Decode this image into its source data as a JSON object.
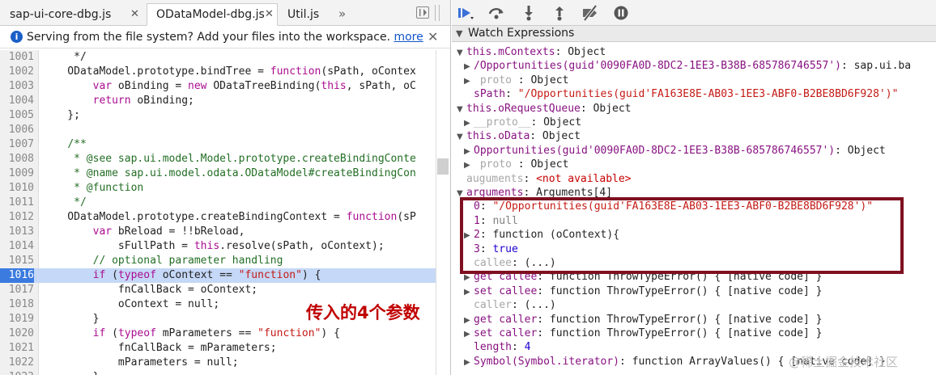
{
  "tabs": [
    {
      "label": "sap-ui-core-dbg.js",
      "close": "✕"
    },
    {
      "label": "ODataModel-dbg.js",
      "close": "✕"
    },
    {
      "label": "Util.js",
      "close": ""
    }
  ],
  "tab_overflow": "»",
  "infobar": {
    "icon": "i",
    "text": "Serving from the file system? Add your files into the workspace.",
    "link": "more",
    "close": "✕"
  },
  "code_lines": [
    {
      "n": "1001",
      "html": "     */"
    },
    {
      "n": "1002",
      "html": "    ODataModel.prototype.bindTree = <span class=\"k\">function</span>(sPath, oContex"
    },
    {
      "n": "1003",
      "html": "        <span class=\"k\">var</span> oBinding = <span class=\"k\">new</span> ODataTreeBinding(<span class=\"k\">this</span>, sPath, oC"
    },
    {
      "n": "1004",
      "html": "        <span class=\"k\">return</span> oBinding;"
    },
    {
      "n": "1005",
      "html": "    };"
    },
    {
      "n": "1006",
      "html": ""
    },
    {
      "n": "1007",
      "html": "    <span class=\"c\">/**</span>"
    },
    {
      "n": "1008",
      "html": "<span class=\"c\">     * @see sap.ui.model.Model.prototype.createBindingConte</span>"
    },
    {
      "n": "1009",
      "html": "<span class=\"c\">     * @name sap.ui.model.odata.ODataModel#createBindingCon</span>"
    },
    {
      "n": "1010",
      "html": "<span class=\"c\">     * @function</span>"
    },
    {
      "n": "1011",
      "html": "<span class=\"c\">     */</span>"
    },
    {
      "n": "1012",
      "html": "    ODataModel.prototype.createBindingContext = <span class=\"k\">function</span>(sP"
    },
    {
      "n": "1013",
      "html": "        <span class=\"k\">var</span> bReload = !!bReload,"
    },
    {
      "n": "1014",
      "html": "            sFullPath = <span class=\"k\">this</span>.resolve(sPath, oContext);"
    },
    {
      "n": "1015",
      "html": "        <span class=\"c\">// optional parameter handling</span>"
    },
    {
      "n": "1016",
      "html": "        <span class=\"k\">if</span> (<span class=\"k\">typeof</span> oContext == <span class=\"s\">\"function\"</span>) {",
      "hl": true
    },
    {
      "n": "1017",
      "html": "            fnCallBack = oContext;"
    },
    {
      "n": "1018",
      "html": "            oContext = null;"
    },
    {
      "n": "1019",
      "html": "        }"
    },
    {
      "n": "1020",
      "html": "        <span class=\"k\">if</span> (<span class=\"k\">typeof</span> mParameters == <span class=\"s\">\"function\"</span>) {"
    },
    {
      "n": "1021",
      "html": "            fnCallBack = mParameters;"
    },
    {
      "n": "1022",
      "html": "            mParameters = null;"
    },
    {
      "n": "1023",
      "html": "        }"
    }
  ],
  "annotation": "传入的4个参数",
  "debug_toolbar": [
    "resume-icon",
    "step-over-icon",
    "step-into-icon",
    "step-out-icon",
    "deactivate-breakpoints-icon",
    "pause-on-exceptions-icon"
  ],
  "watch_title": "Watch Expressions",
  "watch_lines": [
    {
      "indent": 0,
      "tri": "▼",
      "html": "<span class=\"name\">this.mContexts</span>: Object"
    },
    {
      "indent": 1,
      "tri": "▶",
      "html": "<span class=\"name\">/Opportunities(guid'0090FA0D-8DC2-1EE3-B38B-685786746557')</span>: sap.ui.ba"
    },
    {
      "indent": 1,
      "tri": "▶",
      "html": "<span class=\"name dim\"> proto </span>: Object"
    },
    {
      "indent": 1,
      "tri": "",
      "html": "<span class=\"name\">sPath</span>: <span class=\"str\">\"/Opportunities(guid'FA163E8E-AB03-1EE3-ABF0-B2BE8BD6F928')\"</span>"
    },
    {
      "indent": 0,
      "tri": "▼",
      "html": "<span class=\"name\">this.oRequestQueue</span>: Object"
    },
    {
      "indent": 1,
      "tri": "▶",
      "html": "<span class=\"name dim\">__proto__</span>: Object"
    },
    {
      "indent": 0,
      "tri": "▼",
      "html": "<span class=\"name\">this.oData</span>: Object"
    },
    {
      "indent": 1,
      "tri": "▶",
      "html": "<span class=\"name\">Opportunities(guid'0090FA0D-8DC2-1EE3-B38B-685786746557')</span>: Object"
    },
    {
      "indent": 1,
      "tri": "▶",
      "html": "<span class=\"name dim\"> proto </span>: Object"
    },
    {
      "indent": 0,
      "tri": "",
      "html": "<span class=\"dim\">auguments</span>: <span class=\"unavail\">&lt;not available&gt;</span>"
    },
    {
      "indent": 0,
      "tri": "▼",
      "html": "<span class=\"name\">arguments</span>: Arguments[4]"
    },
    {
      "indent": 1,
      "tri": "",
      "html": "<span class=\"name\">0</span>: <span class=\"str\">\"/Opportunities(guid'FA163E8E-AB03-1EE3-ABF0-B2BE8BD6F928')\"</span>"
    },
    {
      "indent": 1,
      "tri": "",
      "html": "<span class=\"name\">1</span>: <span class=\"nullc\">null</span>"
    },
    {
      "indent": 1,
      "tri": "▶",
      "html": "<span class=\"name\">2</span>: function (oContext){"
    },
    {
      "indent": 1,
      "tri": "",
      "html": "<span class=\"name\">3</span>: <span class=\"kw\">true</span>"
    },
    {
      "indent": 1,
      "tri": "",
      "html": "<span class=\"name dim\">callee</span>: (...)"
    },
    {
      "indent": 1,
      "tri": "▶",
      "html": "<span class=\"name\">get callee</span>: function ThrowTypeError() { [native code] }"
    },
    {
      "indent": 1,
      "tri": "▶",
      "html": "<span class=\"name\">set callee</span>: function ThrowTypeError() { [native code] }"
    },
    {
      "indent": 1,
      "tri": "",
      "html": "<span class=\"name dim\">caller</span>: (...)"
    },
    {
      "indent": 1,
      "tri": "▶",
      "html": "<span class=\"name\">get caller</span>: function ThrowTypeError() { [native code] }"
    },
    {
      "indent": 1,
      "tri": "▶",
      "html": "<span class=\"name\">set caller</span>: function ThrowTypeError() { [native code] }"
    },
    {
      "indent": 1,
      "tri": "",
      "html": "<span class=\"name\">length</span>: <span class=\"num\">4</span>"
    },
    {
      "indent": 1,
      "tri": "▶",
      "html": "<span class=\"name\">Symbol(Symbol.iterator)</span>: function ArrayValues() { [native code] }"
    }
  ],
  "watermark": "@稀土掘金技术社区"
}
